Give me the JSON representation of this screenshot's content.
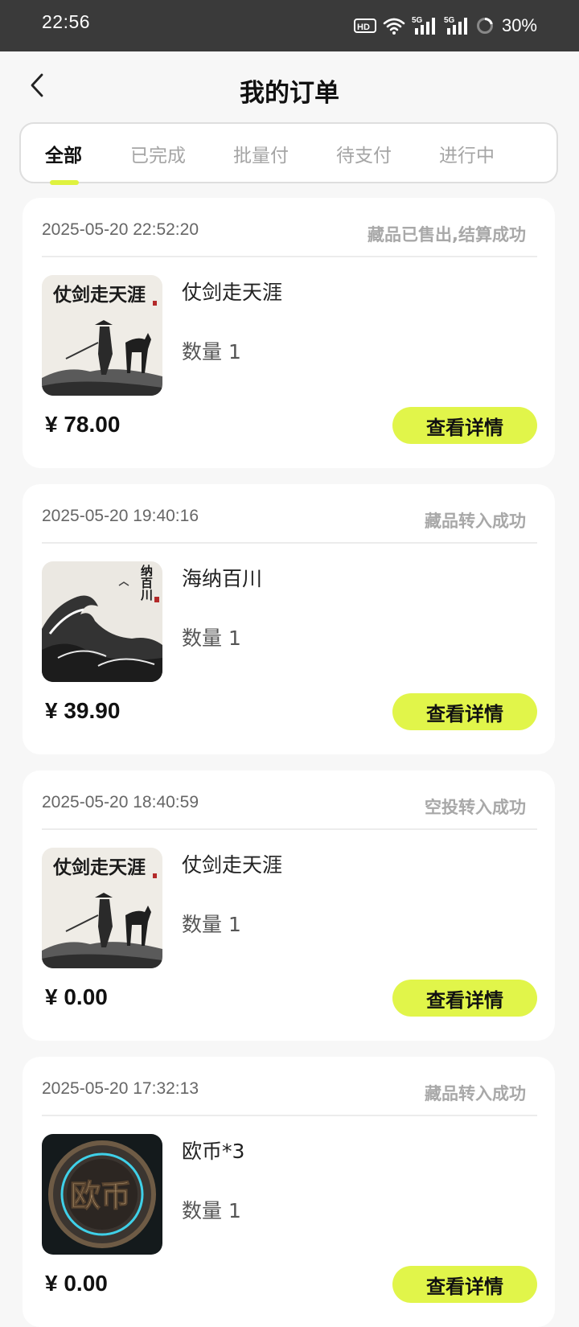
{
  "status_bar": {
    "time": "22:56",
    "network_badge": "HD",
    "signal_1": "5G",
    "signal_2": "5G",
    "battery": "30%"
  },
  "header": {
    "title": "我的订单",
    "back_icon": "chevron-left-icon"
  },
  "tabs": [
    {
      "label": "全部",
      "active": true
    },
    {
      "label": "已完成",
      "active": false
    },
    {
      "label": "批量付",
      "active": false
    },
    {
      "label": "待支付",
      "active": false
    },
    {
      "label": "进行中",
      "active": false
    }
  ],
  "colors": {
    "accent": "#e1f54a",
    "status_text": "#a8a8a8",
    "status_bar_bg": "#3a3a3a",
    "page_bg": "#f7f7f7"
  },
  "orders": [
    {
      "time": "2025-05-20 22:52:20",
      "status": "藏品已售出,结算成功",
      "name": "仗剑走天涯",
      "quantity": "数量 1",
      "price": "¥ 78.00",
      "button": "查看详情",
      "image": "swordsman-ink-painting"
    },
    {
      "time": "2025-05-20 19:40:16",
      "status": "藏品转入成功",
      "name": "海纳百川",
      "quantity": "数量 1",
      "price": "¥ 39.90",
      "button": "查看详情",
      "image": "ocean-wave-ink-painting"
    },
    {
      "time": "2025-05-20 18:40:59",
      "status": "空投转入成功",
      "name": "仗剑走天涯",
      "quantity": "数量 1",
      "price": "¥ 0.00",
      "button": "查看详情",
      "image": "swordsman-ink-painting"
    },
    {
      "time": "2025-05-20 17:32:13",
      "status": "藏品转入成功",
      "name": "欧币*3",
      "quantity": "数量 1",
      "price": "¥ 0.00",
      "button": "查看详情",
      "image": "ou-coin"
    }
  ],
  "image_text": {
    "swordsman": "仗剑走天涯",
    "ocean": "纳百川",
    "coin": "欧币"
  }
}
